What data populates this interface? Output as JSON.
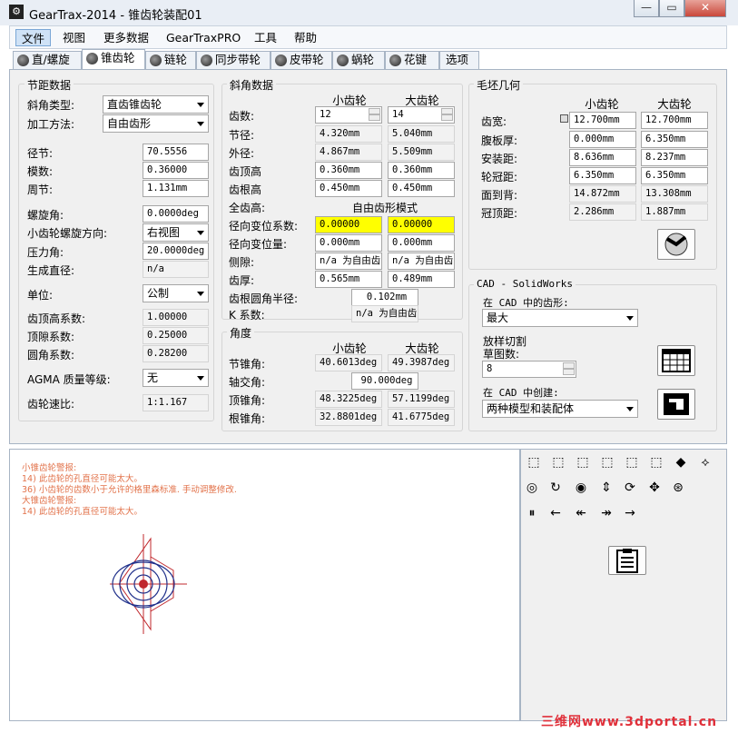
{
  "window": {
    "title": "GearTrax-2014 - 锥齿轮装配01",
    "app_icon": "geartrax-icon",
    "min": "—",
    "max": "▭",
    "close": "✕"
  },
  "menu": [
    "文件",
    "视图",
    "更多数据",
    "GearTraxPRO",
    "工具",
    "帮助"
  ],
  "tabs": [
    "直/螺旋",
    "锥齿轮",
    "链轮",
    "同步带轮",
    "皮带轮",
    "蜗轮",
    "花键",
    "选项"
  ],
  "pitch": {
    "title": "节距数据",
    "bevel_type_label": "斜角类型:",
    "bevel_type": "直齿锥齿轮",
    "method_label": "加工方法:",
    "method": "自由齿形",
    "diametral_pitch_label": "径节:",
    "diametral_pitch": "70.5556",
    "module_label": "模数:",
    "module": "0.36000",
    "circular_pitch_label": "周节:",
    "circular_pitch": "1.131mm",
    "spiral_angle_label": "螺旋角:",
    "spiral_angle": "0.0000deg",
    "hand_label": "小齿轮螺旋方向:",
    "hand": "右视图",
    "pressure_angle_label": "压力角:",
    "pressure_angle": "20.0000deg",
    "gen_dia_label": "生成直径:",
    "gen_dia": "n/a",
    "units_label": "单位:",
    "units": "公制",
    "addendum_label": "齿顶高系数:",
    "addendum": "1.00000",
    "clearance_label": "顶隙系数:",
    "clearance": "0.25000",
    "fillet_label": "圆角系数:",
    "fillet": "0.28200",
    "agma_label": "AGMA 质量等级:",
    "agma": "无",
    "ratio_label": "齿轮速比:",
    "ratio": "1:1.167"
  },
  "bevel": {
    "title": "斜角数据",
    "col_pinion": "小齿轮",
    "col_gear": "大齿轮",
    "rows": [
      {
        "label": "齿数:",
        "p": "12",
        "g": "14"
      },
      {
        "label": "节径:",
        "p": "4.320mm",
        "g": "5.040mm"
      },
      {
        "label": "外径:",
        "p": "4.867mm",
        "g": "5.509mm"
      },
      {
        "label": "齿顶高",
        "p": "0.360mm",
        "g": "0.360mm"
      },
      {
        "label": "齿根高",
        "p": "0.450mm",
        "g": "0.450mm"
      }
    ],
    "whole_depth_label": "全齿高:",
    "whole_depth": "自由齿形模式",
    "rows2": [
      {
        "label": "径向变位系数:",
        "p": "0.00000",
        "g": "0.00000"
      },
      {
        "label": "径向变位量:",
        "p": "0.000mm",
        "g": "0.000mm"
      },
      {
        "label": "侧隙:",
        "p": "n/a 为自由齿",
        "g": "n/a 为自由齿"
      },
      {
        "label": "齿厚:",
        "p": "0.565mm",
        "g": "0.489mm"
      }
    ],
    "root_fillet_label": "齿根圆角半径:",
    "root_fillet": "0.102mm",
    "k_label": "K 系数:",
    "k": "n/a 为自由齿"
  },
  "angles": {
    "title": "角度",
    "col_pinion": "小齿轮",
    "col_gear": "大齿轮",
    "pitch_label": "节锥角:",
    "pitch_p": "40.6013deg",
    "pitch_g": "49.3987deg",
    "shaft_label": "轴交角:",
    "shaft": "90.000deg",
    "face_label": "顶锥角:",
    "face_p": "48.3225deg",
    "face_g": "57.1199deg",
    "root_label": "根锥角:",
    "root_p": "32.8801deg",
    "root_g": "41.6775deg"
  },
  "blank": {
    "title": "毛坯几何",
    "col_pinion": "小齿轮",
    "col_gear": "大齿轮",
    "rows": [
      {
        "label": "齿宽:",
        "p": "12.700mm",
        "g": "12.700mm"
      },
      {
        "label": "腹板厚:",
        "p": "0.000mm",
        "g": "6.350mm"
      },
      {
        "label": "安装距:",
        "p": "8.636mm",
        "g": "8.237mm"
      },
      {
        "label": "轮冠距:",
        "p": "6.350mm",
        "g": "6.350mm"
      },
      {
        "label": "面到背:",
        "p": "14.872mm",
        "g": "13.308mm"
      },
      {
        "label": "冠顶距:",
        "p": "2.286mm",
        "g": "1.887mm"
      }
    ]
  },
  "cad": {
    "title": "CAD - SolidWorks",
    "tooth_label": "在 CAD 中的齿形:",
    "tooth": "最大",
    "loft_label1": "放样切割",
    "loft_label2": "草图数:",
    "loft": "8",
    "create_label": "在 CAD 中创建:",
    "create": "两种模型和装配体"
  },
  "messages": [
    "小锥齿轮警报:",
    "  14) 此齿轮的孔直径可能太大。",
    "  36) 小齿轮的齿数小于允许的格里森标准. 手动调整修改.",
    "大锥齿轮警报:",
    "  14) 此齿轮的孔直径可能太大。"
  ],
  "toolbar_icons": {
    "row1": [
      "view-front-icon",
      "view-back-icon",
      "view-left-icon",
      "view-right-icon",
      "view-top-icon",
      "view-bottom-icon",
      "view-iso-icon",
      "view-plane-icon"
    ],
    "row2": [
      "zoom-fit-icon",
      "rotate-icon",
      "zoom-icon",
      "flip-icon",
      "spin-icon",
      "pan-icon",
      "center-icon"
    ],
    "row3": [
      "pause-icon",
      "step-back-icon",
      "fast-back-icon",
      "fast-forward-icon",
      "step-forward-icon"
    ]
  },
  "watermark": "三维网www.3dportal.cn",
  "colors": {
    "warning": "#e2724a",
    "highlight": "#ffff00",
    "drawing_red": "#c0282d",
    "drawing_blue": "#1f2f8a"
  }
}
